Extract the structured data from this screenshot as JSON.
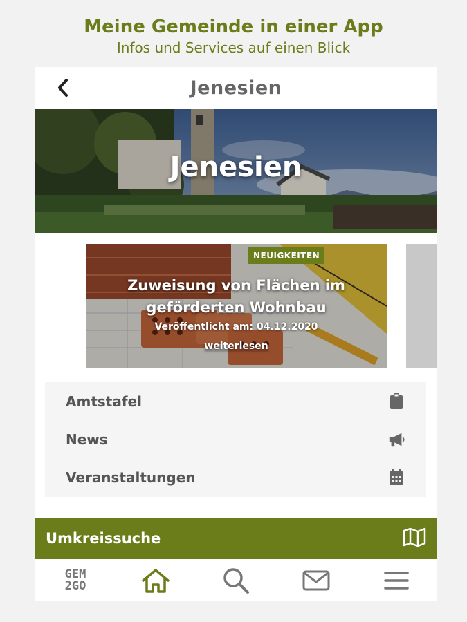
{
  "promo": {
    "title": "Meine Gemeinde in einer App",
    "subtitle": "Infos und Services auf einen Blick"
  },
  "topbar": {
    "back_icon": "chevron-left-icon",
    "title": "Jenesien"
  },
  "hero": {
    "title": "Jenesien"
  },
  "news_card": {
    "badge": "NEUIGKEITEN",
    "title": "Zuweisung von Flächen im geförderten Wohnbau",
    "date": "Veröffentlicht am: 04.12.2020",
    "more": "weiterlesen"
  },
  "menu": {
    "items": [
      {
        "label": "Amtstafel",
        "icon": "clipboard-icon"
      },
      {
        "label": "News",
        "icon": "megaphone-icon"
      },
      {
        "label": "Veranstaltungen",
        "icon": "calendar-icon"
      }
    ]
  },
  "radius_search": {
    "label": "Umkreissuche",
    "icon": "map-icon"
  },
  "bottom_nav": {
    "logo_line1": "GEM",
    "logo_line2": "2GO",
    "items": [
      "home-icon",
      "search-icon",
      "mail-icon",
      "menu-icon"
    ]
  },
  "colors": {
    "brand": "#6b7c1a",
    "text_gray": "#555555",
    "background": "#f2f2f2"
  }
}
